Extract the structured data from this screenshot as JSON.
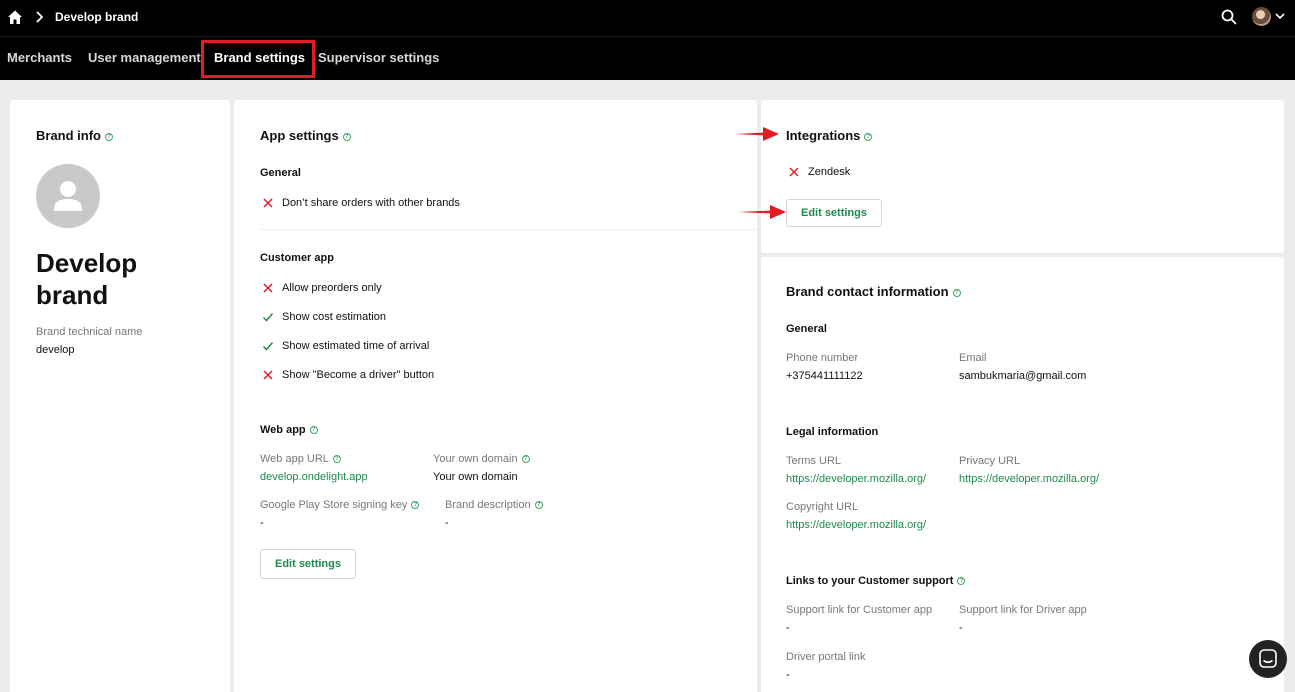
{
  "header": {
    "breadcrumb_title": "Develop brand"
  },
  "tabs": [
    {
      "label": "Merchants"
    },
    {
      "label": "User management"
    },
    {
      "label": "Brand settings"
    },
    {
      "label": "Supervisor settings"
    }
  ],
  "brand_info": {
    "title": "Brand info",
    "name_line1": "Develop",
    "name_line2": "brand",
    "tech_label": "Brand technical name",
    "tech_value": "develop"
  },
  "app_settings": {
    "title": "App settings",
    "general_title": "General",
    "general_items": [
      {
        "label": "Don’t share orders with other brands",
        "enabled": false
      }
    ],
    "customer_title": "Customer app",
    "customer_items": [
      {
        "label": "Allow preorders only",
        "enabled": false
      },
      {
        "label": "Show cost estimation",
        "enabled": true
      },
      {
        "label": "Show estimated time of arrival",
        "enabled": true
      },
      {
        "label": "Show \"Become a driver\" button",
        "enabled": false
      }
    ],
    "web_title": "Web app",
    "web_url_label": "Web app URL",
    "web_url_value": "develop.ondelight.app",
    "domain_label": "Your own domain",
    "domain_value": "Your own domain",
    "gplay_label": "Google Play Store signing key",
    "gplay_value": "-",
    "desc_label": "Brand description",
    "desc_value": "-",
    "edit_label": "Edit settings"
  },
  "integrations": {
    "title": "Integrations",
    "items": [
      {
        "label": "Zendesk",
        "enabled": false
      }
    ],
    "edit_label": "Edit settings"
  },
  "contact": {
    "title": "Brand contact information",
    "general_title": "General",
    "phone_label": "Phone number",
    "phone_value": "+375441111122",
    "email_label": "Email",
    "email_value": "sambukmaria@gmail.com",
    "legal_title": "Legal information",
    "terms_label": "Terms URL",
    "terms_value": "https://developer.mozilla.org/",
    "privacy_label": "Privacy URL",
    "privacy_value": "https://developer.mozilla.org/",
    "copyright_label": "Copyright URL",
    "copyright_value": "https://developer.mozilla.org/",
    "support_title": "Links to your Customer support",
    "support_customer_label": "Support link for Customer app",
    "support_customer_value": "-",
    "support_driver_label": "Support link for Driver app",
    "support_driver_value": "-",
    "driver_portal_label": "Driver portal link",
    "driver_portal_value": "-"
  },
  "colors": {
    "accent": "#1e8a4c",
    "highlight": "#e31b23",
    "error": "#e31b23"
  }
}
